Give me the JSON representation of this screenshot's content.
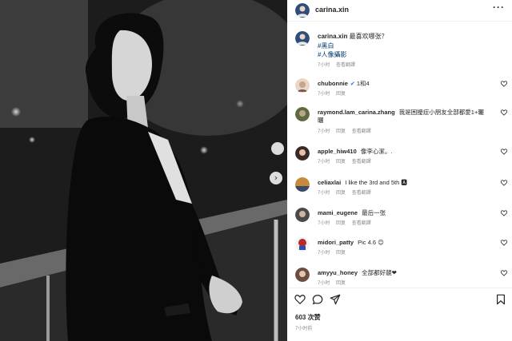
{
  "post": {
    "username": "carina.xin",
    "more": "···",
    "caption": "最喜欢哪张？",
    "tags": [
      "#黑白",
      "#人像攝影"
    ],
    "caption_time": "7小时",
    "caption_translate": "查看翻譯",
    "next_arrow": "›"
  },
  "comments": [
    {
      "user": "chubonnie",
      "text": "1和4",
      "time": "7小时",
      "reply": "回复",
      "translate": "",
      "avatar_color": "#c9a58a"
    },
    {
      "user": "raymond.lam_carina.zhang",
      "text": "我是困擾症小朋友全部都愛1+曬曬",
      "time": "7小时",
      "reply": "回复",
      "translate": "查看翻譯",
      "avatar_color": "#5e6b3e"
    },
    {
      "user": "apple_hiw410",
      "text": "像李心潔。.",
      "time": "7小时",
      "reply": "回复",
      "translate": "查看翻譯",
      "avatar_color": "#3b2a24"
    },
    {
      "user": "celiaxlai",
      "text": "I like the 3rd and 5th 🅰",
      "time": "7小时",
      "reply": "回复",
      "translate": "查看翻譯",
      "avatar_color": "#c8893b"
    },
    {
      "user": "mami_eugene",
      "text": "最后一张",
      "time": "7小时",
      "reply": "回复",
      "translate": "查看翻譯",
      "avatar_color": "#4a4a4a"
    },
    {
      "user": "midori_patty",
      "text": "Pic 4.6 😊",
      "time": "7小时",
      "reply": "回复",
      "translate": "",
      "avatar_color": "#b52b2b"
    },
    {
      "user": "amyyu_honey",
      "text": "全部都好靚❤",
      "time": "7小时",
      "reply": "回复",
      "translate": "",
      "avatar_color": "#6b4e3d"
    }
  ],
  "actions": {
    "likes": "603 次赞",
    "time": "7小时前"
  },
  "colors": {
    "link": "#00376b",
    "muted": "#8e8e8e",
    "text": "#262626"
  }
}
